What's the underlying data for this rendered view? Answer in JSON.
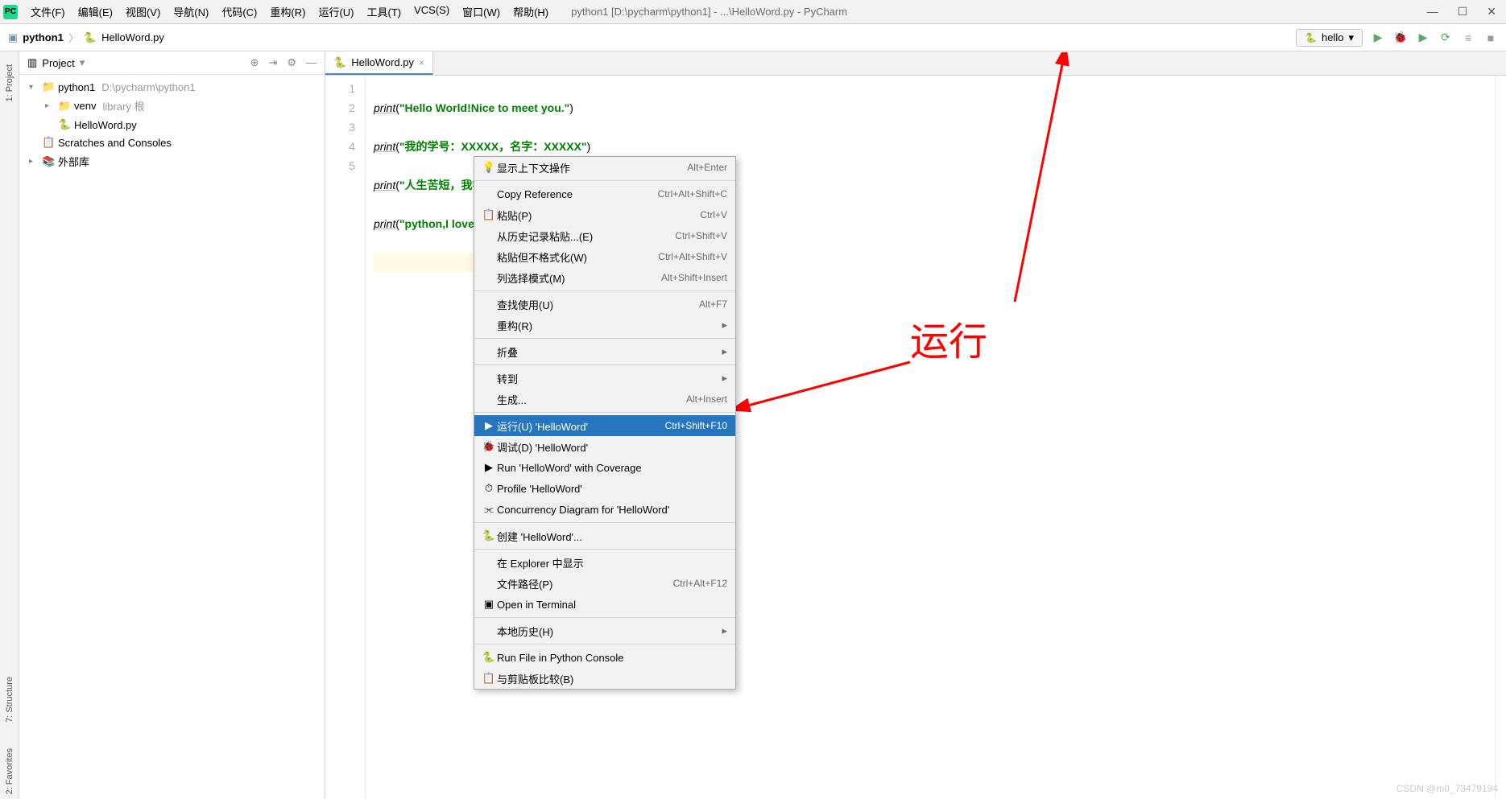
{
  "menubar": {
    "items": [
      "文件(F)",
      "编辑(E)",
      "视图(V)",
      "导航(N)",
      "代码(C)",
      "重构(R)",
      "运行(U)",
      "工具(T)",
      "VCS(S)",
      "窗口(W)",
      "帮助(H)"
    ],
    "title": "python1 [D:\\pycharm\\python1] - ...\\HelloWord.py - PyCharm"
  },
  "breadcrumb": {
    "project": "python1",
    "file": "HelloWord.py"
  },
  "run_config": "hello",
  "left_tabs": [
    "1: Project",
    "7: Structure",
    "2: Favorites"
  ],
  "project_panel": {
    "title": "Project",
    "tree": [
      {
        "indent": 0,
        "arrow": "▾",
        "icon": "📁",
        "label": "python1",
        "path": "D:\\pycharm\\python1"
      },
      {
        "indent": 1,
        "arrow": "▸",
        "icon": "📁",
        "label": "venv",
        "path": "library 根"
      },
      {
        "indent": 1,
        "arrow": "",
        "icon": "🐍",
        "label": "HelloWord.py",
        "path": ""
      },
      {
        "indent": 0,
        "arrow": "",
        "icon": "📋",
        "label": "Scratches and Consoles",
        "path": ""
      },
      {
        "indent": 0,
        "arrow": "▸",
        "icon": "📚",
        "label": "外部库",
        "path": ""
      }
    ]
  },
  "tab": {
    "name": "HelloWord.py"
  },
  "code": {
    "lines": [
      "1",
      "2",
      "3",
      "4",
      "5"
    ],
    "l1_fn": "print",
    "l1_a": "(",
    "l1_s": "\"Hello World!Nice to meet you.\"",
    "l1_b": ")",
    "l2_fn": "print",
    "l2_a": "(",
    "l2_s": "\"我的学号：XXXXX，名字：XXXXX\"",
    "l2_b": ")",
    "l3_fn": "print",
    "l3_a": "(",
    "l3_s": "\"人生苦短，我学python.\"",
    "l3_b": ")",
    "l4_fn": "print",
    "l4_a": "(",
    "l4_s": "\"python,I love you so much\"",
    "l4_b": ")"
  },
  "context_menu": [
    {
      "type": "item",
      "icon": "💡",
      "label": "显示上下文操作",
      "shortcut": "Alt+Enter"
    },
    {
      "type": "sep"
    },
    {
      "type": "item",
      "icon": "",
      "label": "Copy Reference",
      "shortcut": "Ctrl+Alt+Shift+C"
    },
    {
      "type": "item",
      "icon": "📋",
      "label": "粘贴(P)",
      "shortcut": "Ctrl+V"
    },
    {
      "type": "item",
      "icon": "",
      "label": "从历史记录粘贴...(E)",
      "shortcut": "Ctrl+Shift+V"
    },
    {
      "type": "item",
      "icon": "",
      "label": "粘贴但不格式化(W)",
      "shortcut": "Ctrl+Alt+Shift+V"
    },
    {
      "type": "item",
      "icon": "",
      "label": "列选择模式(M)",
      "shortcut": "Alt+Shift+Insert"
    },
    {
      "type": "sep"
    },
    {
      "type": "item",
      "icon": "",
      "label": "查找使用(U)",
      "shortcut": "Alt+F7"
    },
    {
      "type": "item",
      "icon": "",
      "label": "重构(R)",
      "shortcut": "",
      "sub": "▸"
    },
    {
      "type": "sep"
    },
    {
      "type": "item",
      "icon": "",
      "label": "折叠",
      "shortcut": "",
      "sub": "▸"
    },
    {
      "type": "sep"
    },
    {
      "type": "item",
      "icon": "",
      "label": "转到",
      "shortcut": "",
      "sub": "▸"
    },
    {
      "type": "item",
      "icon": "",
      "label": "生成...",
      "shortcut": "Alt+Insert"
    },
    {
      "type": "sep"
    },
    {
      "type": "item",
      "icon": "▶",
      "label": "运行(U) 'HelloWord'",
      "shortcut": "Ctrl+Shift+F10",
      "selected": true
    },
    {
      "type": "item",
      "icon": "🐞",
      "label": "调试(D) 'HelloWord'",
      "shortcut": ""
    },
    {
      "type": "item",
      "icon": "▶",
      "label": "Run 'HelloWord' with Coverage",
      "shortcut": ""
    },
    {
      "type": "item",
      "icon": "⏱",
      "label": "Profile 'HelloWord'",
      "shortcut": ""
    },
    {
      "type": "item",
      "icon": "⫘",
      "label": "Concurrency Diagram for 'HelloWord'",
      "shortcut": ""
    },
    {
      "type": "sep"
    },
    {
      "type": "item",
      "icon": "🐍",
      "label": "创建 'HelloWord'...",
      "shortcut": ""
    },
    {
      "type": "sep"
    },
    {
      "type": "item",
      "icon": "",
      "label": "在 Explorer 中显示",
      "shortcut": ""
    },
    {
      "type": "item",
      "icon": "",
      "label": "文件路径(P)",
      "shortcut": "Ctrl+Alt+F12"
    },
    {
      "type": "item",
      "icon": "▣",
      "label": "Open in Terminal",
      "shortcut": ""
    },
    {
      "type": "sep"
    },
    {
      "type": "item",
      "icon": "",
      "label": "本地历史(H)",
      "shortcut": "",
      "sub": "▸"
    },
    {
      "type": "sep"
    },
    {
      "type": "item",
      "icon": "🐍",
      "label": "Run File in Python Console",
      "shortcut": ""
    },
    {
      "type": "item",
      "icon": "📋",
      "label": "与剪贴板比较(B)",
      "shortcut": ""
    }
  ],
  "annotation": {
    "label": "运行"
  },
  "watermark": "CSDN @m0_73479194"
}
